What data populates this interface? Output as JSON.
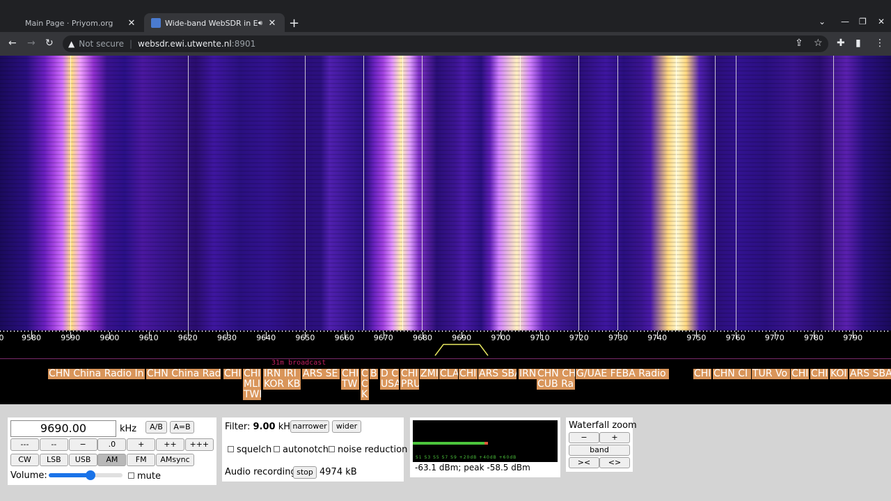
{
  "browser": {
    "tabs": [
      {
        "title": "Main Page · Priyom.org",
        "active": false
      },
      {
        "title": "Wide-band WebSDR in Ensch",
        "active": true
      }
    ],
    "new_tab_label": "+",
    "url": {
      "security": "Not secure",
      "host": "websdr.ewi.utwente.nl",
      "port": ":8901"
    }
  },
  "waterfall": {
    "scale_labels": [
      "9580",
      "9590",
      "9600",
      "9610",
      "9620",
      "9630",
      "9640",
      "9650",
      "9660",
      "9670",
      "9680",
      "9690",
      "9700",
      "9710",
      "9720",
      "9730",
      "9740",
      "9750",
      "9760",
      "9770",
      "9780",
      "9790"
    ],
    "scale_left_fragment": "0",
    "watermark": "31m broadcast"
  },
  "stations": [
    {
      "lines": [
        "CHN China Radio In"
      ]
    },
    {
      "lines": [
        "CHN China Rad"
      ]
    },
    {
      "lines": [
        "CHI"
      ]
    },
    {
      "lines": [
        "CHI",
        "MLI",
        "TWI"
      ]
    },
    {
      "lines": [
        "IRN IRI",
        "KOR KB"
      ]
    },
    {
      "lines": [
        "ARS SE"
      ]
    },
    {
      "lines": [
        "CHI",
        "TW"
      ]
    },
    {
      "lines": [
        "C",
        "C",
        "K"
      ]
    },
    {
      "lines": [
        "B"
      ]
    },
    {
      "lines": [
        "D C",
        "USA"
      ]
    },
    {
      "lines": [
        "CHI",
        "PRU"
      ]
    },
    {
      "lines": [
        "ZMI"
      ]
    },
    {
      "lines": [
        "CLA"
      ]
    },
    {
      "lines": [
        "CHI"
      ]
    },
    {
      "lines": [
        "ARS SBA"
      ]
    },
    {
      "lines": [
        "IRN"
      ]
    },
    {
      "lines": [
        "CHN CH",
        "CUB Ra"
      ]
    },
    {
      "lines": [
        "G/UAE FEBA Radio"
      ]
    },
    {
      "lines": [
        "CHI"
      ]
    },
    {
      "lines": [
        "CHN CI"
      ]
    },
    {
      "lines": [
        "TUR Vo"
      ]
    },
    {
      "lines": [
        "CHI"
      ]
    },
    {
      "lines": [
        "CHI"
      ]
    },
    {
      "lines": [
        "KOI"
      ]
    },
    {
      "lines": [
        "ARS SBA"
      ]
    }
  ],
  "controls": {
    "frequency": "9690.00",
    "unit": "kHz",
    "ab_button": "A/B",
    "aeqb_button": "A=B",
    "step_buttons": [
      "---",
      "--",
      "−",
      ".0",
      "+",
      "++",
      "+++"
    ],
    "modes": [
      "CW",
      "LSB",
      "USB",
      "AM",
      "FM",
      "AMsync"
    ],
    "selected_mode": "AM",
    "volume_label": "Volume:",
    "volume_level": 0.57,
    "mute_label": "mute"
  },
  "filter": {
    "label": "Filter:",
    "value": "9.00",
    "unit": "kHz",
    "narrower": "narrower",
    "wider": "wider",
    "squelch": "squelch",
    "autonotch": "autonotch",
    "noise_reduction": "noise reduction",
    "audio_recording_label": "Audio recording",
    "stop_button": "stop",
    "recorded_size": "4974 kB"
  },
  "smeter": {
    "scale_text": "S1  S3  S5  S7  S9  +20dB  +40dB  +60dB",
    "reading": "-63.1 dBm; peak  -58.5 dBm",
    "level_fraction": 0.52
  },
  "zoom": {
    "title": "Waterfall zoom",
    "minus": "−",
    "plus": "+",
    "band": "band",
    "narrow": "><",
    "wide": "<>"
  },
  "colors": {
    "station_bg": "#d9955a",
    "passband": "#e8e860",
    "waterfall_peak": "#fff0b0"
  }
}
